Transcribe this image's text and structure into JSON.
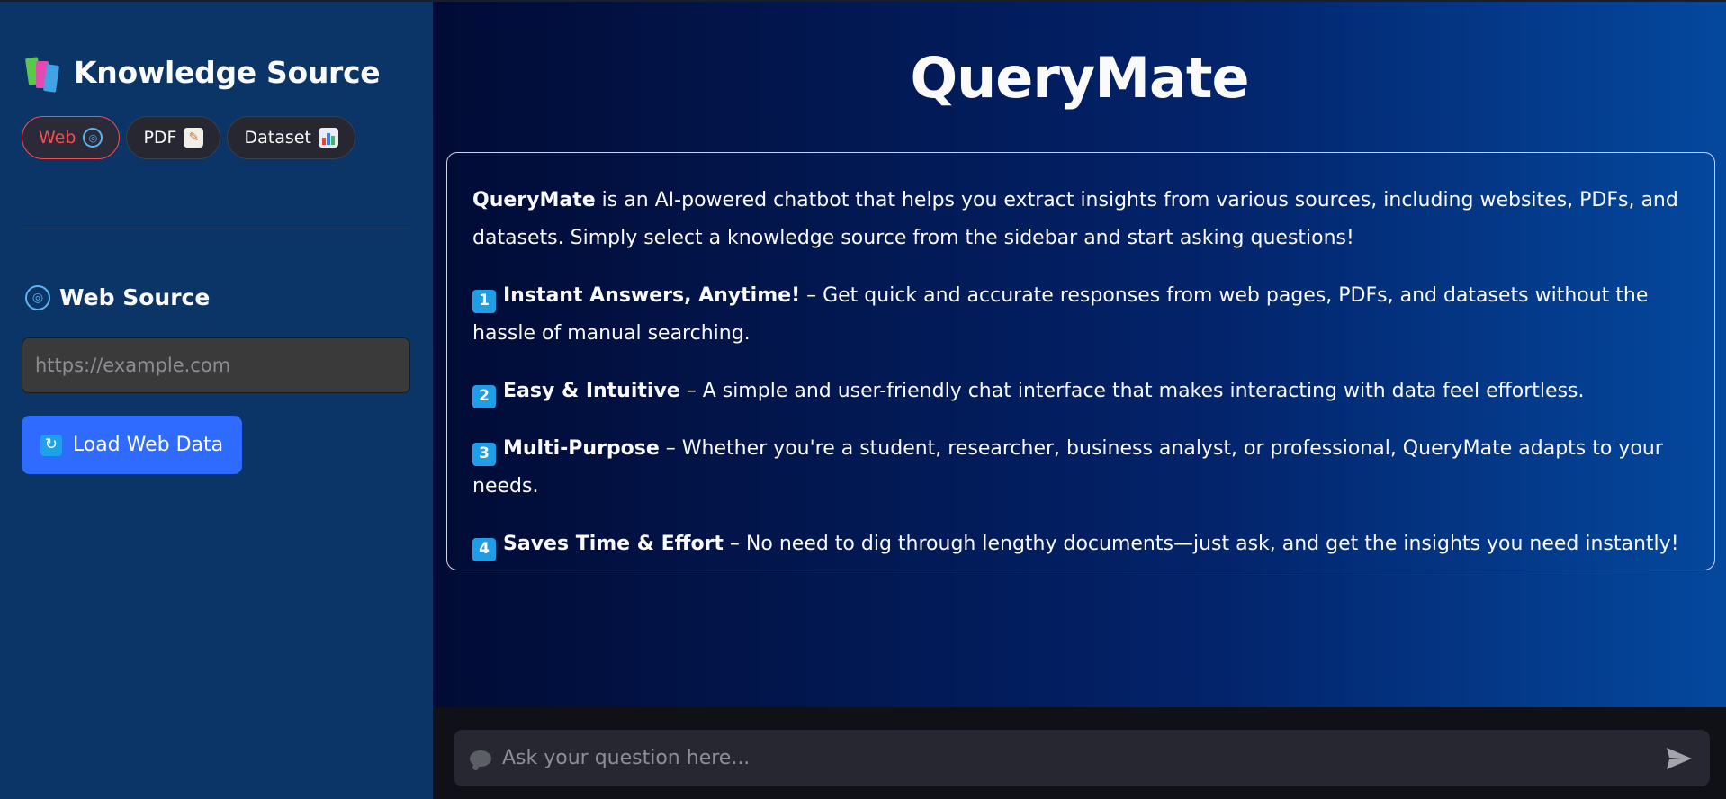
{
  "sidebar": {
    "title": "Knowledge Source",
    "sources": [
      {
        "label": "Web",
        "active": true,
        "icon": "globe-icon"
      },
      {
        "label": "PDF",
        "active": false,
        "icon": "memo-icon"
      },
      {
        "label": "Dataset",
        "active": false,
        "icon": "bar-chart-icon"
      }
    ],
    "section_title": "Web Source",
    "url_placeholder": "https://example.com",
    "url_value": "",
    "load_button_label": "Load Web Data"
  },
  "main": {
    "title": "QueryMate",
    "intro_bold": "QueryMate",
    "intro_text": " is an AI-powered chatbot that helps you extract insights from various sources, including websites, PDFs, and datasets. Simply select a knowledge source from the sidebar and start asking questions!",
    "features": [
      {
        "number": "1",
        "title": "Instant Answers, Anytime!",
        "text": " – Get quick and accurate responses from web pages, PDFs, and datasets without the hassle of manual searching."
      },
      {
        "number": "2",
        "title": "Easy & Intuitive",
        "text": " – A simple and user-friendly chat interface that makes interacting with data feel effortless."
      },
      {
        "number": "3",
        "title": "Multi-Purpose",
        "text": " – Whether you're a student, researcher, business analyst, or professional, QueryMate adapts to your needs."
      },
      {
        "number": "4",
        "title": "Saves Time & Effort",
        "text": " – No need to dig through lengthy documents—just ask, and get the insights you need instantly!"
      }
    ]
  },
  "chat": {
    "placeholder": "Ask your question here..."
  },
  "colors": {
    "sidebar_bg": "#0b3566",
    "accent_active": "#ff4b4b",
    "button_primary": "#2f6bff",
    "badge": "#1f9de6"
  }
}
